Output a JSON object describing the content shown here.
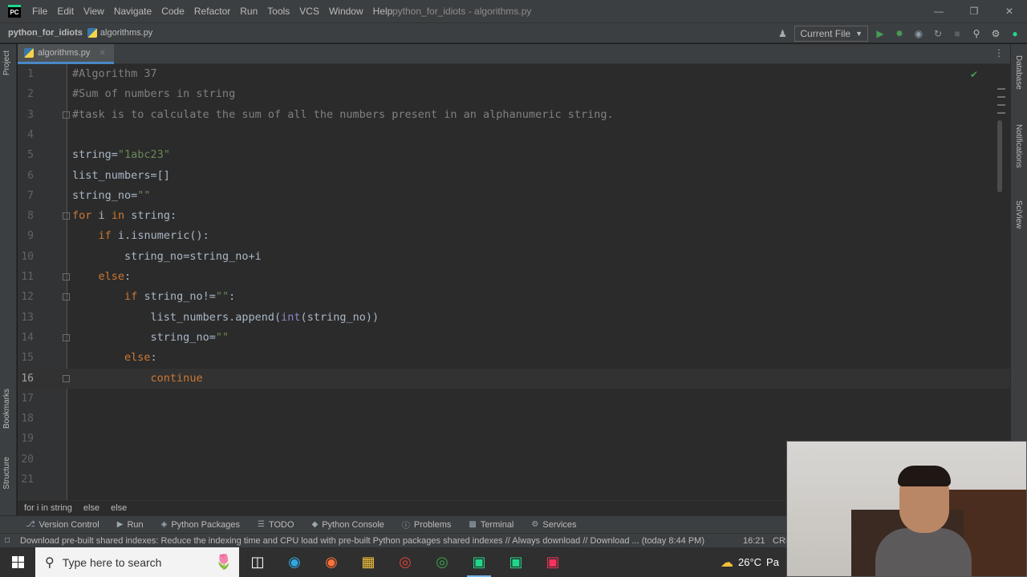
{
  "menu": {
    "logo": "PC",
    "items": [
      "File",
      "Edit",
      "View",
      "Navigate",
      "Code",
      "Refactor",
      "Run",
      "Tools",
      "VCS",
      "Window",
      "Help"
    ],
    "window_title": "python_for_idiots - algorithms.py"
  },
  "nav": {
    "project": "python_for_idiots",
    "file": "algorithms.py",
    "run_config": "Current File"
  },
  "left_tools": {
    "project": "Project",
    "bookmarks": "Bookmarks",
    "structure": "Structure"
  },
  "right_tools": {
    "database": "Database",
    "notifications": "Notifications",
    "sciview": "SciView"
  },
  "tab": {
    "label": "algorithms.py"
  },
  "editor": {
    "current_line": 16,
    "lines": [
      {
        "n": "1",
        "text": "#Algorithm 37"
      },
      {
        "n": "2",
        "text": "#Sum of numbers in string"
      },
      {
        "n": "3",
        "text": "#task is to calculate the sum of all the numbers present in an alphanumeric string."
      },
      {
        "n": "4",
        "text": ""
      },
      {
        "n": "5",
        "text": "string=\"1abc23\""
      },
      {
        "n": "6",
        "text": "list_numbers=[]"
      },
      {
        "n": "7",
        "text": "string_no=\"\""
      },
      {
        "n": "8",
        "text": "for i in string:"
      },
      {
        "n": "9",
        "text": "    if i.isnumeric():"
      },
      {
        "n": "10",
        "text": "        string_no=string_no+i"
      },
      {
        "n": "11",
        "text": "    else:"
      },
      {
        "n": "12",
        "text": "        if string_no!=\"\":"
      },
      {
        "n": "13",
        "text": "            list_numbers.append(int(string_no))"
      },
      {
        "n": "14",
        "text": "            string_no=\"\""
      },
      {
        "n": "15",
        "text": "        else:"
      },
      {
        "n": "16",
        "text": "            continue"
      },
      {
        "n": "17",
        "text": ""
      },
      {
        "n": "18",
        "text": ""
      },
      {
        "n": "19",
        "text": ""
      },
      {
        "n": "20",
        "text": ""
      },
      {
        "n": "21",
        "text": ""
      }
    ]
  },
  "breadcrumbs": [
    "for i in string",
    "else",
    "else"
  ],
  "bottom_tools": [
    "Version Control",
    "Run",
    "Python Packages",
    "TODO",
    "Python Console",
    "Problems",
    "Terminal",
    "Services"
  ],
  "status": {
    "message": "Download pre-built shared indexes: Reduce the indexing time and CPU load with pre-built Python packages shared indexes // Always download // Download ... (today 8:44 PM)",
    "position": "16:21",
    "line_ending": "CRL"
  },
  "taskbar": {
    "search_placeholder": "Type here to search",
    "weather": "26°C",
    "weather_suffix": "Pa"
  },
  "colors": {
    "comment": "#808080",
    "keyword": "#cc7832",
    "string": "#6a8759",
    "builtin": "#8888c6",
    "text": "#a9b7c6",
    "accent": "#4a88c7"
  }
}
